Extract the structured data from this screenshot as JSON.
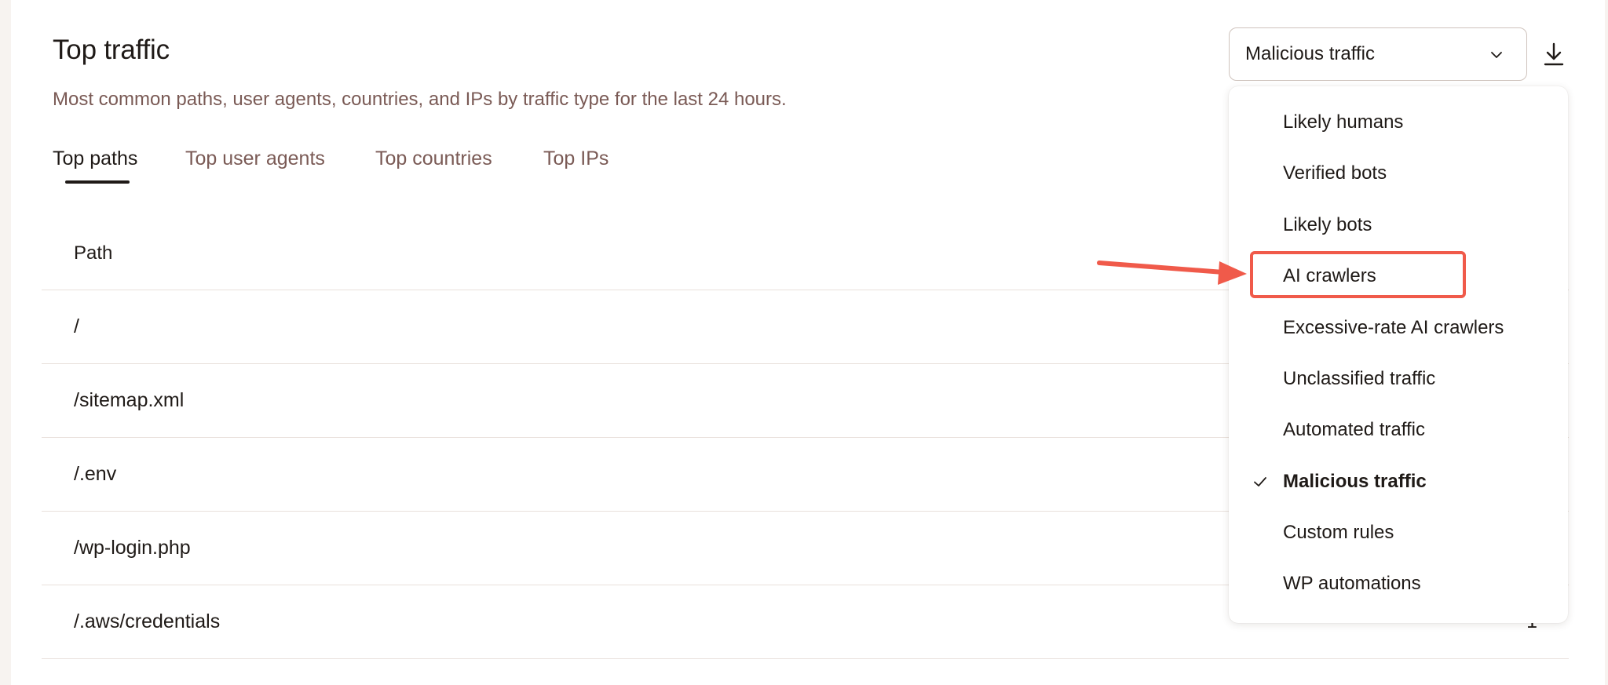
{
  "header": {
    "title": "Top traffic",
    "subtitle": "Most common paths, user agents, countries, and IPs by traffic type for the last 24 hours."
  },
  "tabs": [
    {
      "label": "Top paths",
      "active": true
    },
    {
      "label": "Top user agents",
      "active": false
    },
    {
      "label": "Top countries",
      "active": false
    },
    {
      "label": "Top IPs",
      "active": false
    }
  ],
  "table": {
    "column_path": "Path",
    "rows": [
      {
        "path": "/",
        "count": ""
      },
      {
        "path": "/sitemap.xml",
        "count": ""
      },
      {
        "path": "/.env",
        "count": ""
      },
      {
        "path": "/wp-login.php",
        "count": ""
      },
      {
        "path": "/.aws/credentials",
        "count": "1"
      }
    ]
  },
  "traffic_select": {
    "value": "Malicious traffic",
    "options": [
      "Likely humans",
      "Verified bots",
      "Likely bots",
      "AI crawlers",
      "Excessive-rate AI crawlers",
      "Unclassified traffic",
      "Automated traffic",
      "Malicious traffic",
      "Custom rules",
      "WP automations"
    ],
    "selected_index": 7,
    "highlighted_option": "AI crawlers"
  },
  "icons": {
    "select": "chevron-down-icon",
    "download": "download-icon",
    "check": "check-icon",
    "annotation": "arrow-annotation"
  },
  "colors": {
    "accent_text": "#7a5a55",
    "annotation": "#f05a4a"
  }
}
